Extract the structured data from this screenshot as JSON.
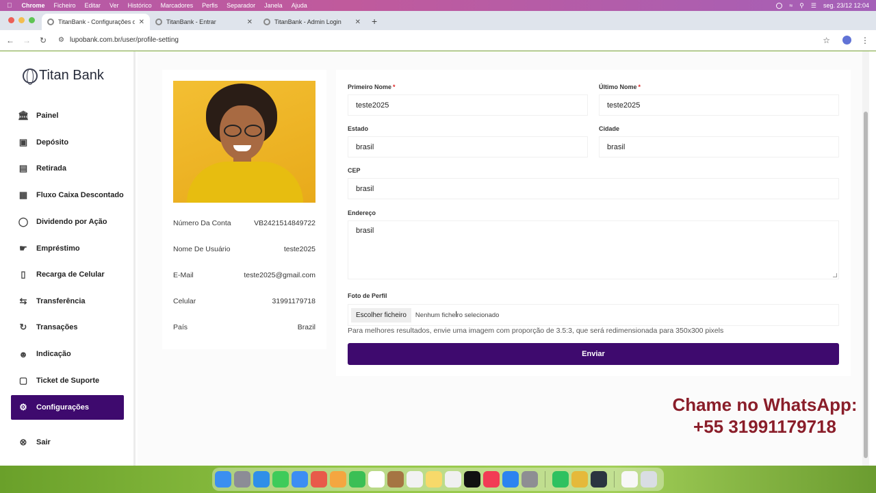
{
  "menubar": {
    "app": "Chrome",
    "items": [
      "Ficheiro",
      "Editar",
      "Ver",
      "Histórico",
      "Marcadores",
      "Perfis",
      "Separador",
      "Janela",
      "Ajuda"
    ],
    "datetime": "seg. 23/12  12:04"
  },
  "browser": {
    "tabs": [
      {
        "title": "TitanBank - Configurações d",
        "active": true
      },
      {
        "title": "TitanBank - Entrar",
        "active": false
      },
      {
        "title": "TitanBank - Admin Login",
        "active": false
      }
    ],
    "url": "lupobank.com.br/user/profile-setting"
  },
  "sidebar": {
    "logo_text": "Titan Bank",
    "items": [
      {
        "label": "Painel",
        "icon": "bank-icon"
      },
      {
        "label": "Depósito",
        "icon": "wallet-icon"
      },
      {
        "label": "Retirada",
        "icon": "cash-icon"
      },
      {
        "label": "Fluxo Caixa Descontado",
        "icon": "receipt-icon"
      },
      {
        "label": "Dividendo por Ação",
        "icon": "piggy-bank-icon"
      },
      {
        "label": "Empréstimo",
        "icon": "hand-coin-icon"
      },
      {
        "label": "Recarga de Celular",
        "icon": "phone-icon"
      },
      {
        "label": "Transferência",
        "icon": "transfer-icon"
      },
      {
        "label": "Transações",
        "icon": "refresh-icon"
      },
      {
        "label": "Indicação",
        "icon": "users-icon"
      },
      {
        "label": "Ticket de Suporte",
        "icon": "ticket-icon"
      },
      {
        "label": "Configurações",
        "icon": "gear-icon",
        "active": true
      },
      {
        "label": "Sair",
        "icon": "logout-icon"
      }
    ]
  },
  "profile": {
    "rows": [
      {
        "key": "Número Da Conta",
        "value": "VB2421514849722"
      },
      {
        "key": "Nome De Usuário",
        "value": "teste2025"
      },
      {
        "key": "E-Mail",
        "value": "teste2025@gmail.com"
      },
      {
        "key": "Celular",
        "value": "31991179718"
      },
      {
        "key": "País",
        "value": "Brazil"
      }
    ]
  },
  "form": {
    "first_name_label": "Primeiro Nome",
    "first_name_value": "teste2025",
    "last_name_label": "Último Nome",
    "last_name_value": "teste2025",
    "required_mark": "*",
    "state_label": "Estado",
    "state_value": "brasil",
    "city_label": "Cidade",
    "city_value": "brasil",
    "cep_label": "CEP",
    "cep_value": "brasil",
    "address_label": "Endereço",
    "address_value": "brasil",
    "photo_label": "Foto de Perfil",
    "file_button": "Escolher ficheiro",
    "file_status": "Nenhum ficheiro selecionado",
    "hint": "Para melhores resultados, envie uma imagem com proporção de 3.5:3, que será redimensionada para 350x300 pixels",
    "submit": "Enviar"
  },
  "overlay": {
    "line1": "Chame no WhatsApp:",
    "line2": "+55 31991179718"
  },
  "colors": {
    "accent": "#3e0a6e",
    "overlay_text": "#8a1e2a"
  }
}
